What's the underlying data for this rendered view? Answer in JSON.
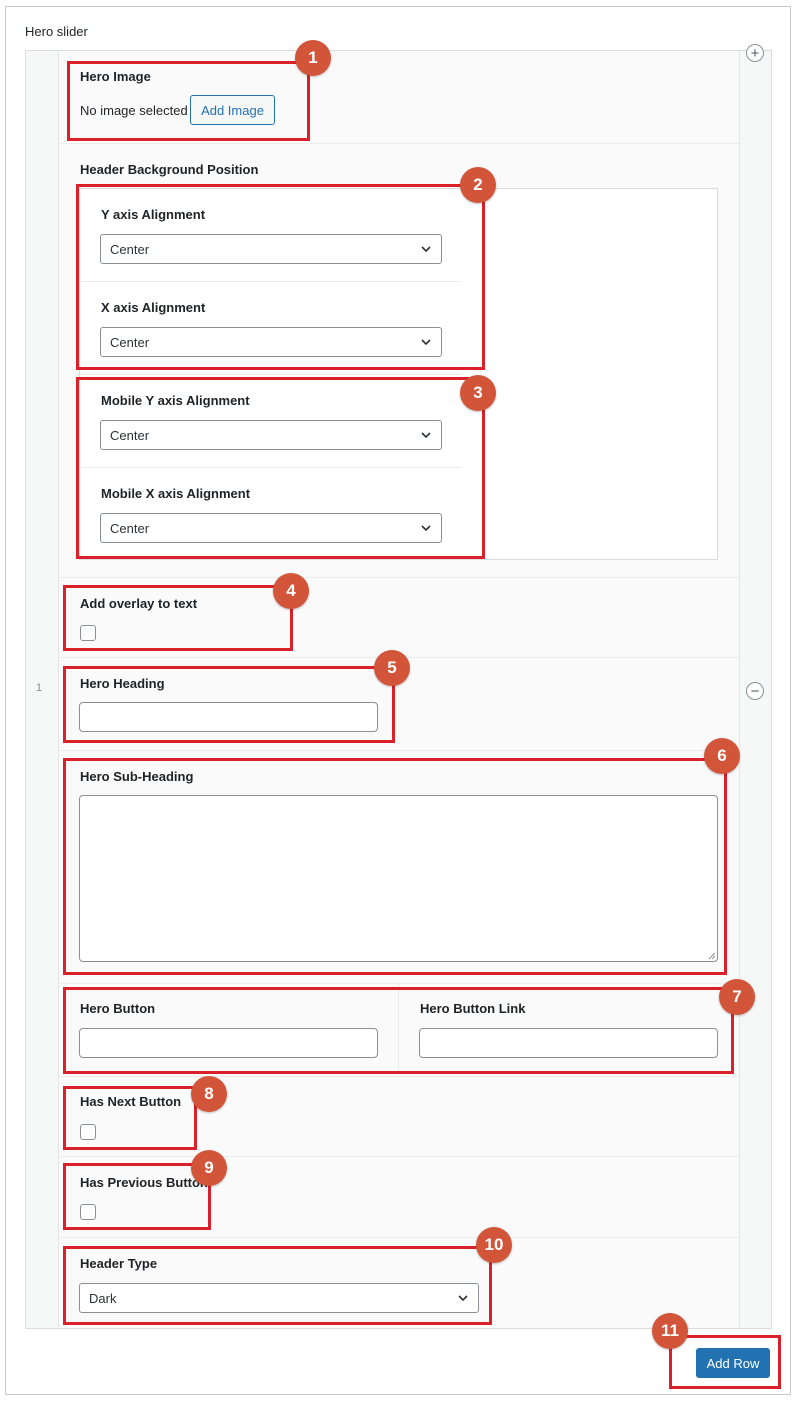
{
  "section_title": "Hero slider",
  "row_number": "1",
  "hero_image": {
    "label": "Hero Image",
    "status": "No image selected",
    "button": "Add Image"
  },
  "bg_position": {
    "label": "Header Background Position",
    "y_axis": {
      "label": "Y axis Alignment",
      "value": "Center"
    },
    "x_axis": {
      "label": "X axis Alignment",
      "value": "Center"
    },
    "mobile_y_axis": {
      "label": "Mobile Y axis Alignment",
      "value": "Center"
    },
    "mobile_x_axis": {
      "label": "Mobile X axis Alignment",
      "value": "Center"
    }
  },
  "overlay": {
    "label": "Add overlay to text",
    "checked": false
  },
  "hero_heading": {
    "label": "Hero Heading",
    "value": ""
  },
  "hero_subheading": {
    "label": "Hero Sub-Heading",
    "value": ""
  },
  "hero_button": {
    "label": "Hero Button",
    "value": ""
  },
  "hero_button_link": {
    "label": "Hero Button Link",
    "value": ""
  },
  "has_next": {
    "label": "Has Next Button",
    "checked": false
  },
  "has_previous": {
    "label": "Has Previous Button",
    "checked": false
  },
  "header_type": {
    "label": "Header Type",
    "value": "Dark"
  },
  "add_row_button": "Add Row",
  "badges": [
    "1",
    "2",
    "3",
    "4",
    "5",
    "6",
    "7",
    "8",
    "9",
    "10",
    "11"
  ],
  "colors": {
    "highlight": "#d9202b",
    "badge": "#d2553a",
    "primary": "#2271b1"
  }
}
